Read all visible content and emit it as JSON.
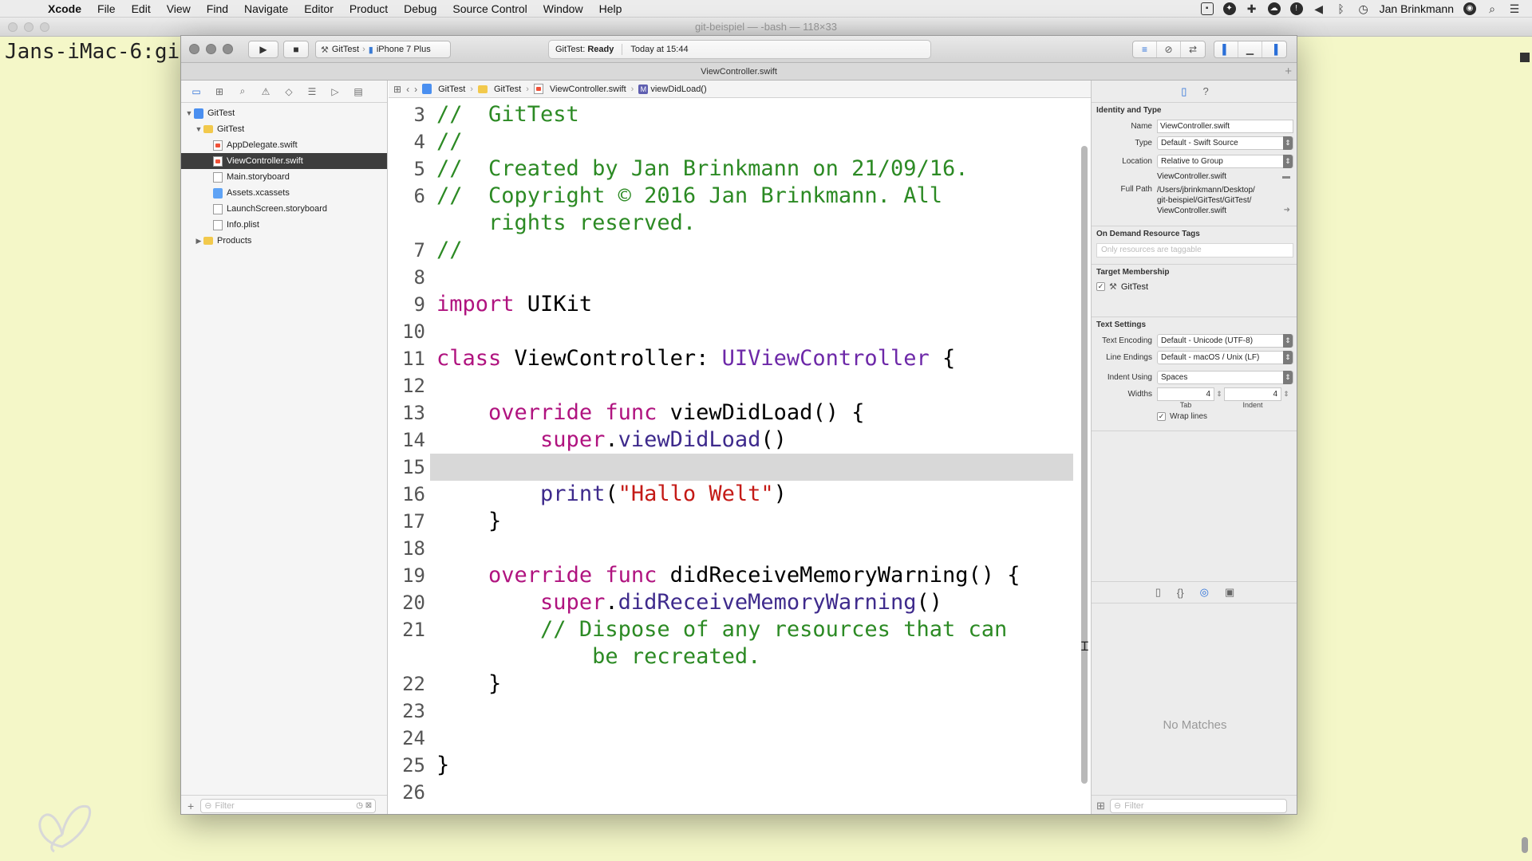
{
  "menubar": {
    "app": "Xcode",
    "items": [
      "File",
      "Edit",
      "View",
      "Find",
      "Navigate",
      "Editor",
      "Product",
      "Debug",
      "Source Control",
      "Window",
      "Help"
    ],
    "user": "Jan Brinkmann"
  },
  "terminal": {
    "title": "git-beispiel — -bash — 118×33",
    "prompt": "Jans-iMac-6:gi"
  },
  "toolbar": {
    "scheme": "GitTest",
    "device": "iPhone 7 Plus",
    "status_project": "GitTest:",
    "status_state": "Ready",
    "status_time": "Today at 15:44"
  },
  "tab": {
    "title": "ViewController.swift"
  },
  "navigator": {
    "tree": [
      {
        "label": "GitTest",
        "level": 0,
        "icon": "project-icon",
        "disclosure": "▼",
        "selected": false
      },
      {
        "label": "GitTest",
        "level": 1,
        "icon": "folder-icon",
        "disclosure": "▼",
        "selected": false
      },
      {
        "label": "AppDelegate.swift",
        "level": 2,
        "icon": "swift-file-icon",
        "disclosure": "",
        "selected": false
      },
      {
        "label": "ViewController.swift",
        "level": 2,
        "icon": "swift-file-icon",
        "disclosure": "",
        "selected": true
      },
      {
        "label": "Main.storyboard",
        "level": 2,
        "icon": "document-icon",
        "disclosure": "",
        "selected": false
      },
      {
        "label": "Assets.xcassets",
        "level": 2,
        "icon": "assets-icon",
        "disclosure": "",
        "selected": false
      },
      {
        "label": "LaunchScreen.storyboard",
        "level": 2,
        "icon": "document-icon",
        "disclosure": "",
        "selected": false
      },
      {
        "label": "Info.plist",
        "level": 2,
        "icon": "document-icon",
        "disclosure": "",
        "selected": false
      },
      {
        "label": "Products",
        "level": 1,
        "icon": "folder-icon",
        "disclosure": "▶",
        "selected": false
      }
    ],
    "filter_placeholder": "Filter"
  },
  "jumpbar": {
    "crumbs": [
      "GitTest",
      "GitTest",
      "ViewController.swift",
      "viewDidLoad()"
    ]
  },
  "editor": {
    "highlighted_line": 15,
    "lines": [
      {
        "n": "3",
        "tokens": [
          {
            "t": "//  GitTest",
            "c": "cmt"
          }
        ]
      },
      {
        "n": "4",
        "tokens": [
          {
            "t": "//",
            "c": "cmt"
          }
        ]
      },
      {
        "n": "5",
        "tokens": [
          {
            "t": "//  Created by Jan Brinkmann on 21/09/16.",
            "c": "cmt"
          }
        ]
      },
      {
        "n": "6",
        "tokens": [
          {
            "t": "//  Copyright © 2016 Jan Brinkmann. All",
            "c": "cmt"
          }
        ]
      },
      {
        "n": "",
        "tokens": [
          {
            "t": "    rights reserved.",
            "c": "cmt"
          }
        ]
      },
      {
        "n": "7",
        "tokens": [
          {
            "t": "//",
            "c": "cmt"
          }
        ]
      },
      {
        "n": "8",
        "tokens": []
      },
      {
        "n": "9",
        "tokens": [
          {
            "t": "import",
            "c": "kw"
          },
          {
            "t": " UIKit",
            "c": ""
          }
        ]
      },
      {
        "n": "10",
        "tokens": []
      },
      {
        "n": "11",
        "tokens": [
          {
            "t": "class",
            "c": "kw"
          },
          {
            "t": " ViewController: ",
            "c": ""
          },
          {
            "t": "UIViewController",
            "c": "ty"
          },
          {
            "t": " {",
            "c": ""
          }
        ]
      },
      {
        "n": "12",
        "tokens": []
      },
      {
        "n": "13",
        "tokens": [
          {
            "t": "    ",
            "c": ""
          },
          {
            "t": "override",
            "c": "kw"
          },
          {
            "t": " ",
            "c": ""
          },
          {
            "t": "func",
            "c": "kw"
          },
          {
            "t": " viewDidLoad() {",
            "c": ""
          }
        ]
      },
      {
        "n": "14",
        "tokens": [
          {
            "t": "        ",
            "c": ""
          },
          {
            "t": "super",
            "c": "kw"
          },
          {
            "t": ".",
            "c": ""
          },
          {
            "t": "viewDidLoad",
            "c": "fn"
          },
          {
            "t": "()",
            "c": ""
          }
        ]
      },
      {
        "n": "15",
        "tokens": []
      },
      {
        "n": "16",
        "tokens": [
          {
            "t": "        ",
            "c": ""
          },
          {
            "t": "print",
            "c": "fn"
          },
          {
            "t": "(",
            "c": ""
          },
          {
            "t": "\"Hallo Welt\"",
            "c": "str"
          },
          {
            "t": ")",
            "c": ""
          }
        ]
      },
      {
        "n": "17",
        "tokens": [
          {
            "t": "    }",
            "c": ""
          }
        ]
      },
      {
        "n": "18",
        "tokens": []
      },
      {
        "n": "19",
        "tokens": [
          {
            "t": "    ",
            "c": ""
          },
          {
            "t": "override",
            "c": "kw"
          },
          {
            "t": " ",
            "c": ""
          },
          {
            "t": "func",
            "c": "kw"
          },
          {
            "t": " didReceiveMemoryWarning() {",
            "c": ""
          }
        ]
      },
      {
        "n": "20",
        "tokens": [
          {
            "t": "        ",
            "c": ""
          },
          {
            "t": "super",
            "c": "kw"
          },
          {
            "t": ".",
            "c": ""
          },
          {
            "t": "didReceiveMemoryWarning",
            "c": "fn"
          },
          {
            "t": "()",
            "c": ""
          }
        ]
      },
      {
        "n": "21",
        "tokens": [
          {
            "t": "        ",
            "c": ""
          },
          {
            "t": "// Dispose of any resources that can",
            "c": "cmt"
          }
        ]
      },
      {
        "n": "",
        "tokens": [
          {
            "t": "            be recreated.",
            "c": "cmt"
          }
        ]
      },
      {
        "n": "22",
        "tokens": [
          {
            "t": "    }",
            "c": ""
          }
        ]
      },
      {
        "n": "23",
        "tokens": []
      },
      {
        "n": "24",
        "tokens": []
      },
      {
        "n": "25",
        "tokens": [
          {
            "t": "}",
            "c": ""
          }
        ]
      },
      {
        "n": "26",
        "tokens": []
      }
    ]
  },
  "inspector": {
    "identity": {
      "title": "Identity and Type",
      "name_label": "Name",
      "name_value": "ViewController.swift",
      "type_label": "Type",
      "type_value": "Default - Swift Source",
      "location_label": "Location",
      "location_value": "Relative to Group",
      "location_file": "ViewController.swift",
      "fullpath_label": "Full Path",
      "fullpath_line1": "/Users/jbrinkmann/Desktop/",
      "fullpath_line2": "git-beispiel/GitTest/GitTest/",
      "fullpath_line3": "ViewController.swift"
    },
    "tags": {
      "title": "On Demand Resource Tags",
      "placeholder": "Only resources are taggable"
    },
    "membership": {
      "title": "Target Membership",
      "target": "GitTest"
    },
    "text_settings": {
      "title": "Text Settings",
      "encoding_label": "Text Encoding",
      "encoding_value": "Default - Unicode (UTF-8)",
      "endings_label": "Line Endings",
      "endings_value": "Default - macOS / Unix (LF)",
      "indent_label": "Indent Using",
      "indent_value": "Spaces",
      "widths_label": "Widths",
      "tab_value": "4",
      "indent_value_num": "4",
      "tab_caption": "Tab",
      "indent_caption": "Indent",
      "wrap_label": "Wrap lines"
    },
    "library_empty": "No Matches",
    "filter_placeholder": "Filter"
  }
}
